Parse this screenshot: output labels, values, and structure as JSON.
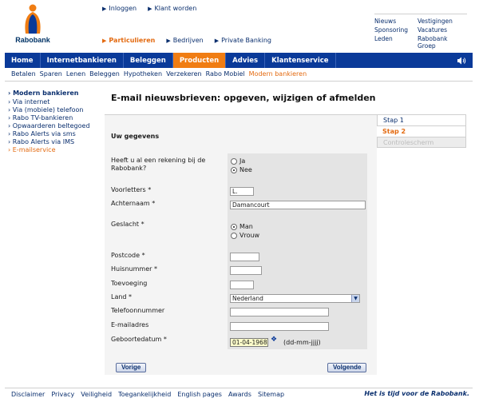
{
  "brand": {
    "name": "Rabobank",
    "accent": "#f07d13",
    "navy": "#0a3a99"
  },
  "toplinks": [
    "Inloggen",
    "Klant worden"
  ],
  "segments": [
    {
      "label": "Particulieren",
      "active": true
    },
    {
      "label": "Bedrijven",
      "active": false
    },
    {
      "label": "Private Banking",
      "active": false
    }
  ],
  "utility": [
    "Nieuws",
    "Vestigingen",
    "Sponsoring",
    "Vacatures",
    "Leden",
    "Rabobank Groep"
  ],
  "mainnav": [
    {
      "label": "Home",
      "active": false
    },
    {
      "label": "Internetbankieren",
      "active": false
    },
    {
      "label": "Beleggen",
      "active": false
    },
    {
      "label": "Producten",
      "active": true
    },
    {
      "label": "Advies",
      "active": false
    },
    {
      "label": "Klantenservice",
      "active": false
    }
  ],
  "subnav": [
    {
      "label": "Betalen",
      "active": false
    },
    {
      "label": "Sparen",
      "active": false
    },
    {
      "label": "Lenen",
      "active": false
    },
    {
      "label": "Beleggen",
      "active": false
    },
    {
      "label": "Hypotheken",
      "active": false
    },
    {
      "label": "Verzekeren",
      "active": false
    },
    {
      "label": "Rabo Mobiel",
      "active": false
    },
    {
      "label": "Modern bankieren",
      "active": true
    }
  ],
  "leftmenu": {
    "heading": "Modern bankieren",
    "items": [
      {
        "label": "Via internet",
        "active": false
      },
      {
        "label": "Via (mobiele) telefoon",
        "active": false
      },
      {
        "label": "Rabo TV-bankieren",
        "active": false
      },
      {
        "label": "Opwaarderen beltegoed",
        "active": false
      },
      {
        "label": "Rabo Alerts via sms",
        "active": false
      },
      {
        "label": "Rabo Alerts via IMS",
        "active": false
      },
      {
        "label": "E-mailservice",
        "active": true
      }
    ]
  },
  "page": {
    "title": "E-mail nieuwsbrieven: opgeven, wijzigen of afmelden"
  },
  "steps": [
    {
      "label": "Stap 1",
      "state": "done"
    },
    {
      "label": "Stap 2",
      "state": "current"
    },
    {
      "label": "Controlescherm",
      "state": "disabled"
    }
  ],
  "form": {
    "section": "Uw gegevens",
    "rekening": {
      "label_1": "Heeft u al een rekening bij de",
      "label_2": "Rabobank?",
      "options": [
        "Ja",
        "Nee"
      ],
      "selected": "Nee"
    },
    "voorletters": {
      "label": "Voorletters *",
      "value": "L."
    },
    "achternaam": {
      "label": "Achternaam *",
      "value": "Damancourt"
    },
    "geslacht": {
      "label": "Geslacht *",
      "options": [
        "Man",
        "Vrouw"
      ],
      "selected": "Man"
    },
    "postcode": {
      "label": "Postcode *",
      "value": ""
    },
    "huisnummer": {
      "label": "Huisnummer *",
      "value": ""
    },
    "toevoeging": {
      "label": "Toevoeging",
      "value": ""
    },
    "land": {
      "label": "Land *",
      "value": "Nederland"
    },
    "telefoon": {
      "label": "Telefoonnummer",
      "value": ""
    },
    "email": {
      "label": "E-mailadres",
      "value": ""
    },
    "geboortedatum": {
      "label": "Geboortedatum *",
      "value": "01-04-1968",
      "hint": "(dd-mm-jjjj)"
    },
    "prev_label": "Vorige",
    "next_label": "Volgende"
  },
  "footer": [
    "Disclaimer",
    "Privacy",
    "Veiligheid",
    "Toegankelijkheid",
    "English pages",
    "Awards",
    "Sitemap"
  ],
  "slogan": "Het is tijd voor de Rabobank."
}
